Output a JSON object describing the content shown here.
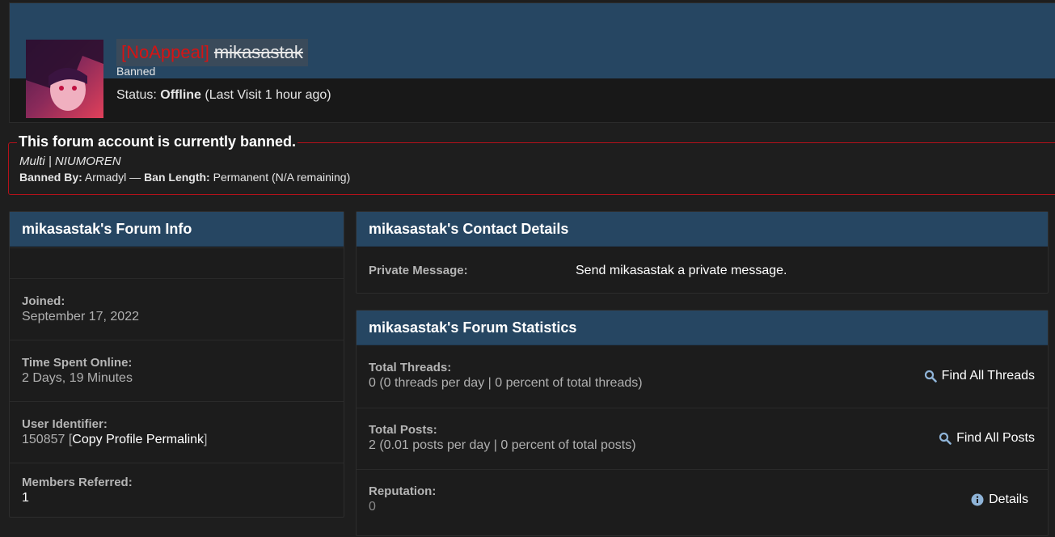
{
  "profile": {
    "name_tag": "[NoAppeal]",
    "username": "mikasastak",
    "usertitle": "Banned",
    "status_label": "Status:",
    "status_value": "Offline",
    "last_visit": "(Last Visit 1 hour ago)"
  },
  "ban": {
    "title": "This forum account is currently banned.",
    "reason": "Multi | NIUMOREN",
    "banned_by_label": "Banned By:",
    "banned_by_value": "Armadyl",
    "separator": "—",
    "ban_length_label": "Ban Length:",
    "ban_length_value": "Permanent (N/A remaining)"
  },
  "forum_info": {
    "title": "mikasastak's Forum Info",
    "joined_label": "Joined:",
    "joined_value": "September 17, 2022",
    "time_online_label": "Time Spent Online:",
    "time_online_value": "2 Days, 19 Minutes",
    "user_id_label": "User Identifier:",
    "user_id_value": "150857",
    "permalink_label": "Copy Profile Permalink",
    "referred_label": "Members Referred:",
    "referred_value": "1"
  },
  "contact": {
    "title": "mikasastak's Contact Details",
    "pm_label": "Private Message:",
    "pm_value": "Send mikasastak a private message."
  },
  "stats": {
    "title": "mikasastak's Forum Statistics",
    "threads_label": "Total Threads:",
    "threads_value": "0 (0 threads per day | 0 percent of total threads)",
    "find_threads": "Find All Threads",
    "posts_label": "Total Posts:",
    "posts_value": "2 (0.01 posts per day | 0 percent of total posts)",
    "find_posts": "Find All Posts",
    "reputation_label": "Reputation:",
    "reputation_value": "0",
    "details": "Details"
  },
  "colors": {
    "accent_blue": "#264662",
    "ban_red": "#b3111a",
    "tag_red": "#d51414"
  },
  "icons": [
    "avatar-image",
    "search-icon",
    "info-icon"
  ]
}
